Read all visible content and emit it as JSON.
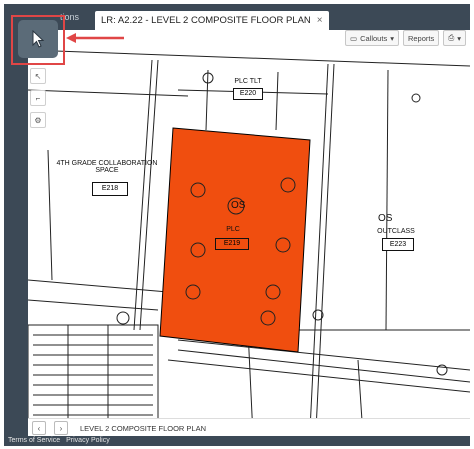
{
  "tabs": {
    "inactive_label": "tions",
    "active_label": "LR: A2.22 - LEVEL 2 COMPOSITE FLOOR PLAN",
    "close_glyph": "×"
  },
  "toolbar": {
    "callouts_label": "Callouts",
    "reports_label": "Reports"
  },
  "plan": {
    "room_e218_name_line1": "4TH GRADE COLLABORATION",
    "room_e218_name_line2": "SPACE",
    "room_e218_number": "E218",
    "room_e220_name": "PLC TLT",
    "room_e220_number": "E220",
    "room_e219_name": "PLC",
    "room_e219_number": "E219",
    "room_e223_name": "OUTCLASS",
    "room_e223_number": "E223",
    "os_label_1": "OS",
    "os_label_2": "OS",
    "highlight_color": "#f04e0f",
    "select_box_color": "#e04646"
  },
  "bottom": {
    "sheet_name": "LEVEL 2 COMPOSITE FLOOR PLAN",
    "prev": "‹",
    "next": "›"
  },
  "footer": {
    "terms": "Terms of Service",
    "privacy": "Privacy Policy"
  }
}
